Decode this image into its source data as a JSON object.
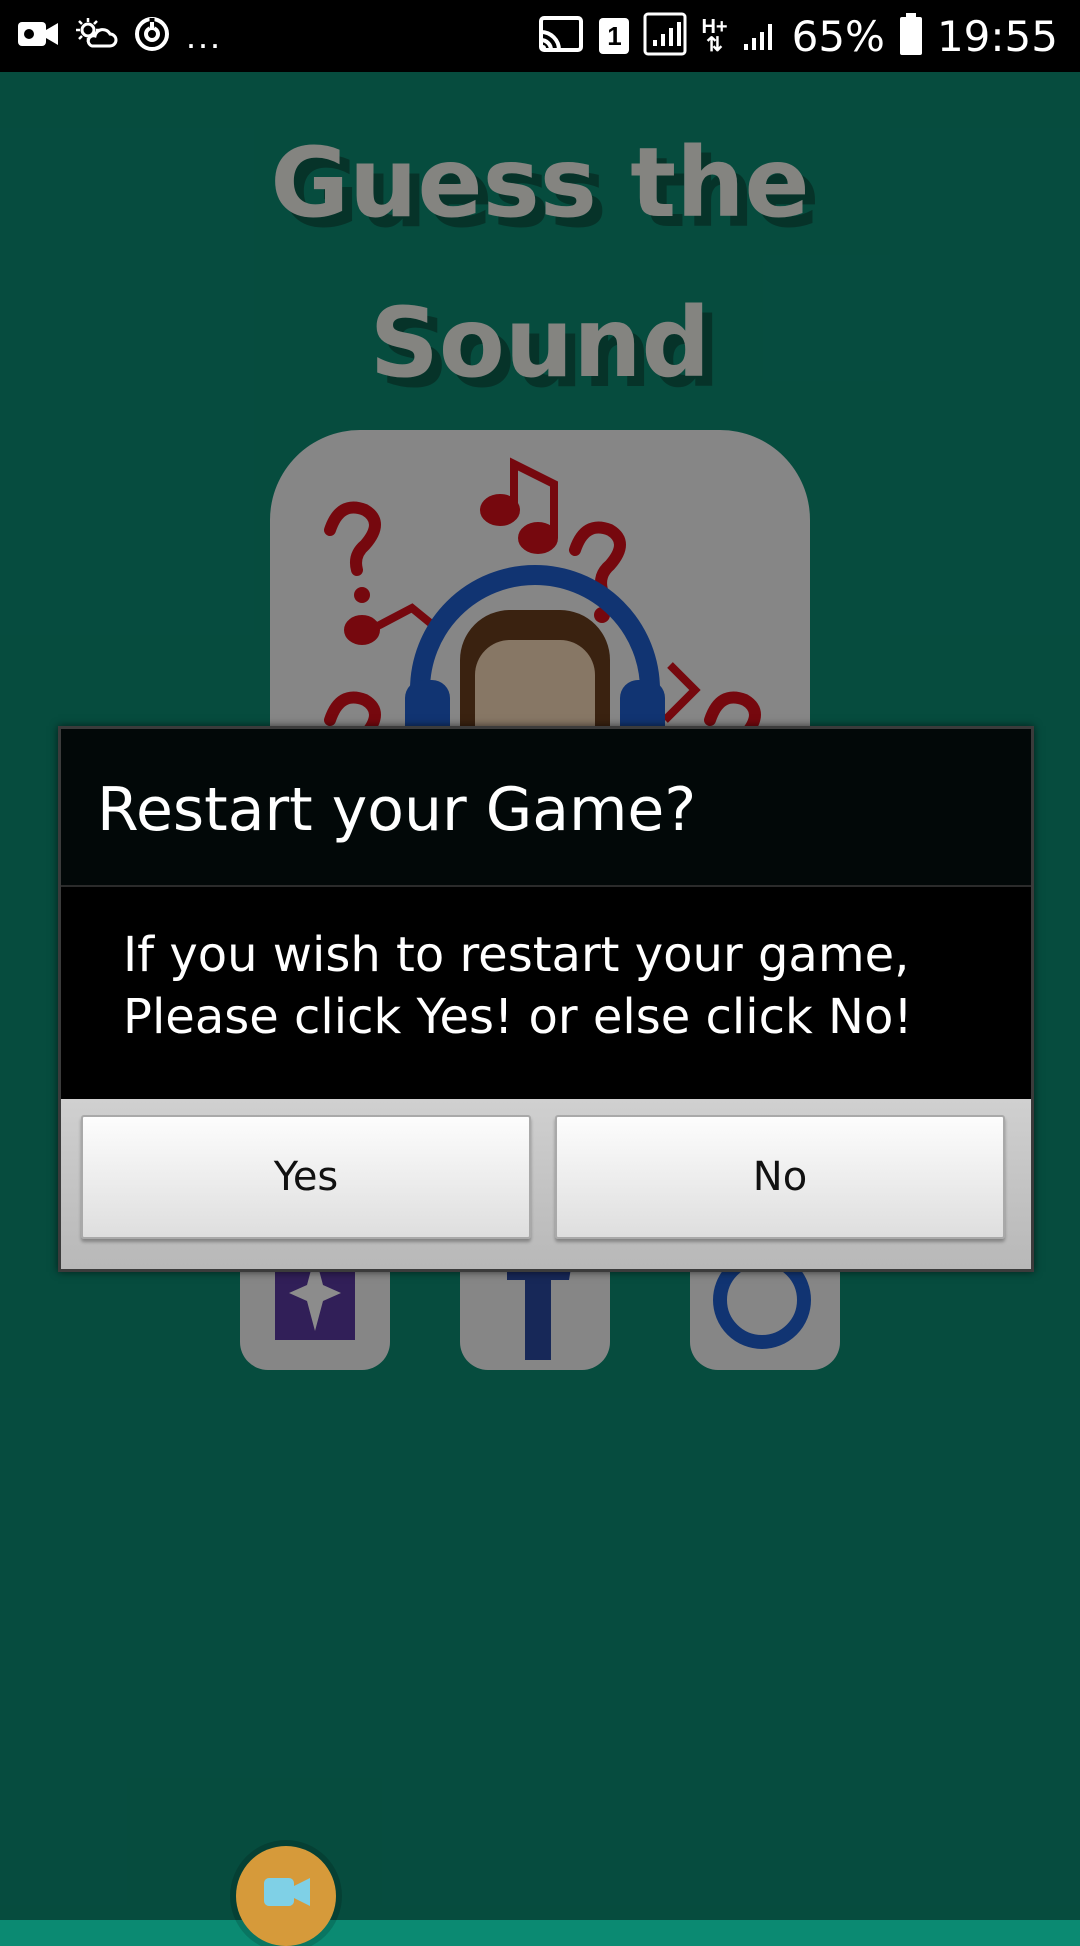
{
  "status_bar": {
    "battery_percent": "65%",
    "time": "19:55",
    "overflow": "...",
    "sim_slot": "1",
    "network_type": "H+",
    "icons": [
      "video-record-icon",
      "weather-icon",
      "sync-icon",
      "cast-icon",
      "sim-icon",
      "signal-icon",
      "data-arrows-icon",
      "signal-icon",
      "battery-icon"
    ]
  },
  "app": {
    "title_line1": "Guess the",
    "title_line2": "Sound",
    "logo_icons": [
      "question-mark-icon",
      "music-note-icon",
      "headphones-icon"
    ],
    "buttons": [
      "rate-icon",
      "facebook-icon",
      "restart-icon"
    ],
    "fab_icon": "video-camera-icon"
  },
  "dialog": {
    "title": "Restart your Game?",
    "message_line1": "If you wish to restart your game,",
    "message_line2": "Please click Yes! or else click No!",
    "yes_label": "Yes",
    "no_label": "No"
  },
  "colors": {
    "background": "#0b8a72",
    "dialog_bg": "#000000",
    "fab": "#d69a3a",
    "logo_accent": "#d8101a",
    "headphones": "#1f5fd0"
  }
}
